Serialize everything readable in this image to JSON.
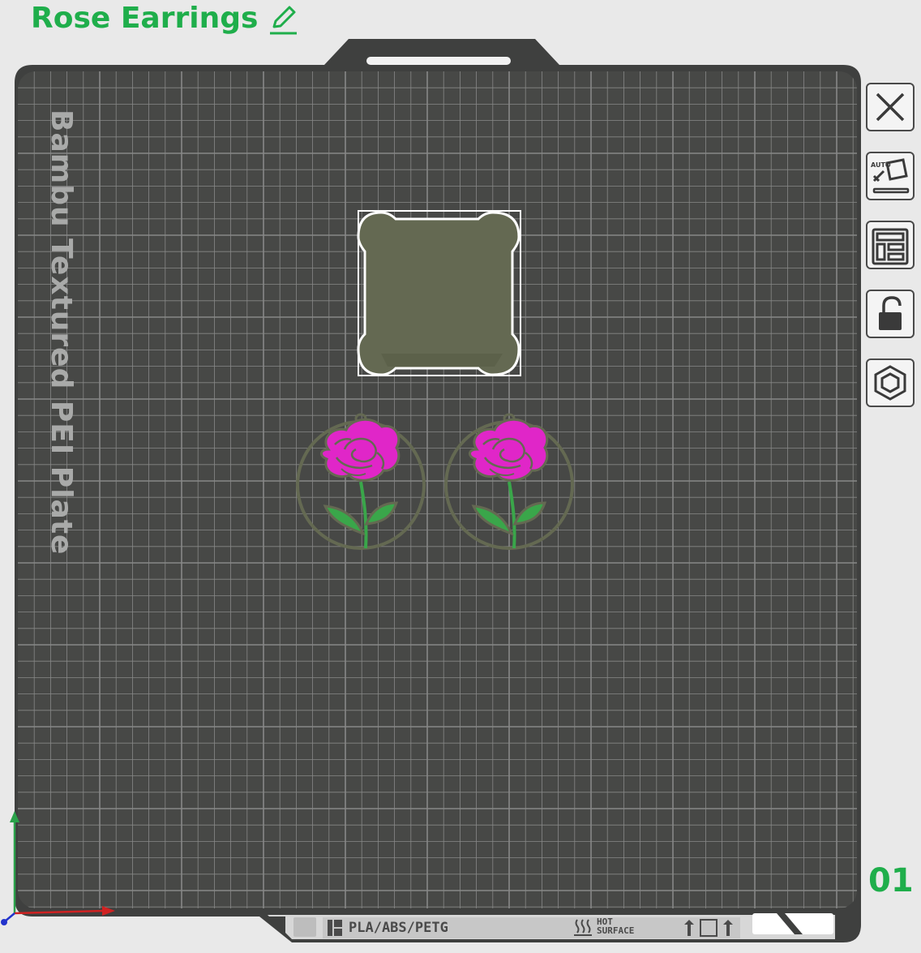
{
  "header": {
    "project_title": "Rose Earrings",
    "edit_icon": "pencil-icon"
  },
  "plate": {
    "label": "Bambu Textured PEI Plate",
    "number": "01",
    "bottom_strip": {
      "filament_text": "PLA/ABS/PETG",
      "hot_surface_line1": "HOT",
      "hot_surface_line2": "SURFACE"
    },
    "colors": {
      "bed": "#474846",
      "grid": "#878887",
      "object_olive": "#646952",
      "rose_pink": "#e026c8",
      "leaf_green": "#3aa64a",
      "accent_green": "#1fae4b"
    },
    "objects": [
      {
        "name": "prime-tower"
      },
      {
        "name": "rose-earring-left"
      },
      {
        "name": "rose-earring-right"
      }
    ]
  },
  "toolbar": {
    "items": [
      {
        "name": "close",
        "icon": "close-icon"
      },
      {
        "name": "auto-orient",
        "icon": "auto-orient-icon",
        "label": "AUTO"
      },
      {
        "name": "arrange",
        "icon": "arrange-layout-icon"
      },
      {
        "name": "lock",
        "icon": "lock-icon"
      },
      {
        "name": "plate-settings",
        "icon": "hex-nut-icon"
      }
    ]
  }
}
